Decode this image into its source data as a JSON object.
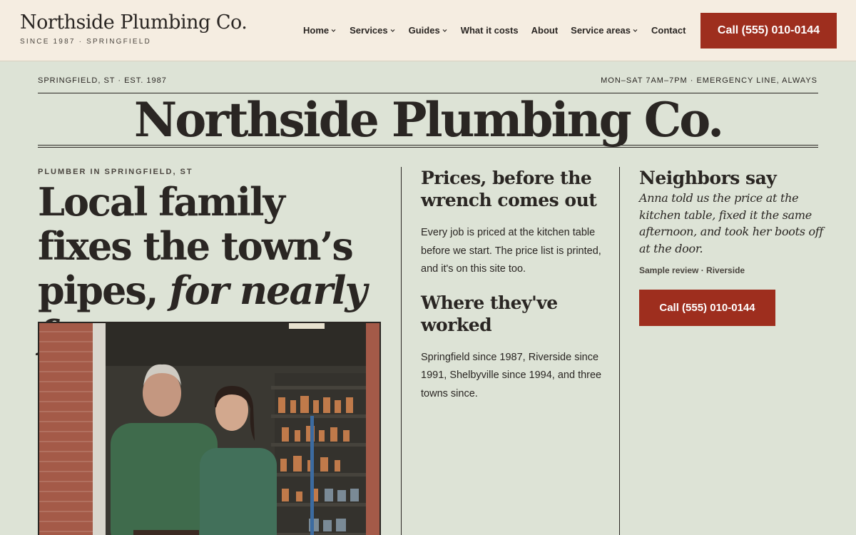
{
  "brand": {
    "name": "Northside Plumbing Co.",
    "tagline": "SINCE 1987 · SPRINGFIELD"
  },
  "nav": {
    "items": [
      {
        "label": "Home",
        "has_menu": true
      },
      {
        "label": "Services",
        "has_menu": true
      },
      {
        "label": "Guides",
        "has_menu": true
      },
      {
        "label": "What it costs",
        "has_menu": false
      },
      {
        "label": "About",
        "has_menu": false
      },
      {
        "label": "Service areas",
        "has_menu": true
      },
      {
        "label": "Contact",
        "has_menu": false
      }
    ],
    "call_label": "Call (555) 010-0144"
  },
  "masthead": {
    "meta_left": "SPRINGFIELD, ST · EST. 1987",
    "meta_right": "MON–SAT 7AM–7PM · EMERGENCY LINE, ALWAYS",
    "title": "Northside Plumbing Co."
  },
  "lead": {
    "kicker": "PLUMBER IN SPRINGFIELD, ST",
    "headline_roman": "Local family fixes the town’s pipes, ",
    "headline_italic": "for nearly forty years",
    "photo_alt": "Two plumbers in green work shirts standing in front of a workshop shelf stocked with copper fittings"
  },
  "prices": {
    "heading": "Prices, before the wrench comes out",
    "body": "Every job is priced at the kitchen table before we start. The price list is printed, and it's on this site too."
  },
  "areas": {
    "heading": "Where they've worked",
    "body": "Springfield since 1987, Riverside since 1991, Shelbyville since 1994, and three towns since."
  },
  "review": {
    "heading": "Neighbors say",
    "quote": "Anna told us the price at the kitchen table, fixed it the same afternoon, and took her boots off at the door.",
    "attribution": "Sample review · Riverside",
    "call_label": "Call (555) 010-0144"
  },
  "colors": {
    "header_bg": "#f5ede1",
    "page_bg": "#dde3d6",
    "accent": "#9e2e1e",
    "ink": "#2a2623"
  }
}
